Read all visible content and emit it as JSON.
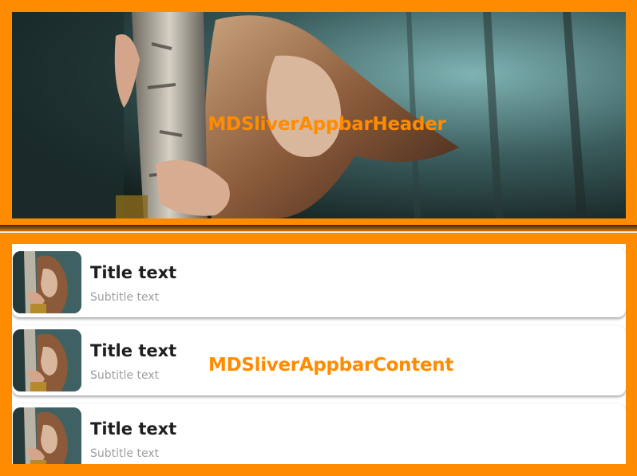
{
  "header": {
    "label": "MDSliverAppbarHeader",
    "image": "forest-portrait-photo",
    "border_color": "#ff8c00"
  },
  "content": {
    "label": "MDSliverAppbarContent",
    "background_color": "#ff8c00",
    "items": [
      {
        "title": "Title text",
        "subtitle": "Subtitle text",
        "image": "forest-portrait-thumbnail"
      },
      {
        "title": "Title text",
        "subtitle": "Subtitle text",
        "image": "forest-portrait-thumbnail"
      },
      {
        "title": "Title text",
        "subtitle": "Subtitle text",
        "image": "forest-portrait-thumbnail"
      }
    ]
  }
}
